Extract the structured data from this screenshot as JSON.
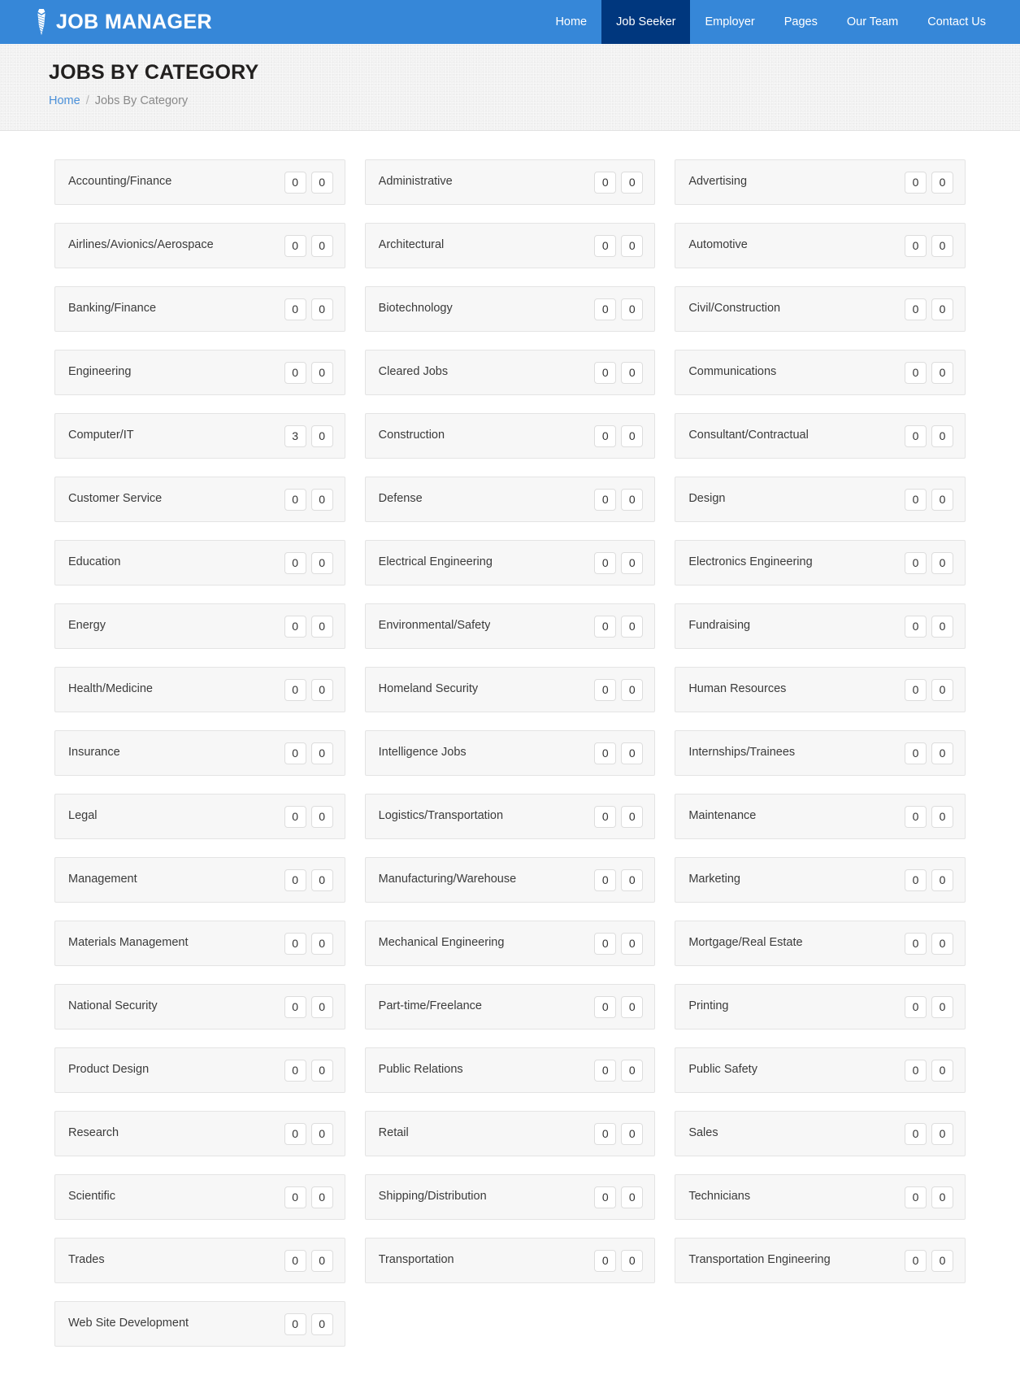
{
  "header": {
    "brand": "JOB MANAGER",
    "brand_icon": "necktie-icon",
    "nav": [
      {
        "label": "Home",
        "active": false
      },
      {
        "label": "Job Seeker",
        "active": true
      },
      {
        "label": "Employer",
        "active": false
      },
      {
        "label": "Pages",
        "active": false
      },
      {
        "label": "Our Team",
        "active": false
      },
      {
        "label": "Contact Us",
        "active": false
      }
    ]
  },
  "banner": {
    "title": "JOBS BY CATEGORY",
    "breadcrumb": {
      "home": "Home",
      "separator": "/",
      "current": "Jobs By Category"
    }
  },
  "colors": {
    "header_blue": "#3687d8",
    "active_nav": "#00377e",
    "link_blue": "#4a90d9",
    "banner_bg": "#f1f1f1",
    "card_bg": "#f7f7f7",
    "card_border": "#e4e4e4",
    "badge_bg": "#ffffff",
    "badge_border": "#dddddd"
  },
  "categories": [
    {
      "name": "Accounting/Finance",
      "count_a": "0",
      "count_b": "0"
    },
    {
      "name": "Administrative",
      "count_a": "0",
      "count_b": "0"
    },
    {
      "name": "Advertising",
      "count_a": "0",
      "count_b": "0"
    },
    {
      "name": "Airlines/Avionics/Aerospace",
      "count_a": "0",
      "count_b": "0"
    },
    {
      "name": "Architectural",
      "count_a": "0",
      "count_b": "0"
    },
    {
      "name": "Automotive",
      "count_a": "0",
      "count_b": "0"
    },
    {
      "name": "Banking/Finance",
      "count_a": "0",
      "count_b": "0"
    },
    {
      "name": "Biotechnology",
      "count_a": "0",
      "count_b": "0"
    },
    {
      "name": "Civil/Construction",
      "count_a": "0",
      "count_b": "0"
    },
    {
      "name": "Engineering",
      "count_a": "0",
      "count_b": "0"
    },
    {
      "name": "Cleared Jobs",
      "count_a": "0",
      "count_b": "0"
    },
    {
      "name": "Communications",
      "count_a": "0",
      "count_b": "0"
    },
    {
      "name": "Computer/IT",
      "count_a": "3",
      "count_b": "0"
    },
    {
      "name": "Construction",
      "count_a": "0",
      "count_b": "0"
    },
    {
      "name": "Consultant/Contractual",
      "count_a": "0",
      "count_b": "0"
    },
    {
      "name": "Customer Service",
      "count_a": "0",
      "count_b": "0"
    },
    {
      "name": "Defense",
      "count_a": "0",
      "count_b": "0"
    },
    {
      "name": "Design",
      "count_a": "0",
      "count_b": "0"
    },
    {
      "name": "Education",
      "count_a": "0",
      "count_b": "0"
    },
    {
      "name": "Electrical Engineering",
      "count_a": "0",
      "count_b": "0"
    },
    {
      "name": "Electronics Engineering",
      "count_a": "0",
      "count_b": "0"
    },
    {
      "name": "Energy",
      "count_a": "0",
      "count_b": "0"
    },
    {
      "name": "Environmental/Safety",
      "count_a": "0",
      "count_b": "0"
    },
    {
      "name": "Fundraising",
      "count_a": "0",
      "count_b": "0"
    },
    {
      "name": "Health/Medicine",
      "count_a": "0",
      "count_b": "0"
    },
    {
      "name": "Homeland Security",
      "count_a": "0",
      "count_b": "0"
    },
    {
      "name": "Human Resources",
      "count_a": "0",
      "count_b": "0"
    },
    {
      "name": "Insurance",
      "count_a": "0",
      "count_b": "0"
    },
    {
      "name": "Intelligence Jobs",
      "count_a": "0",
      "count_b": "0"
    },
    {
      "name": "Internships/Trainees",
      "count_a": "0",
      "count_b": "0"
    },
    {
      "name": "Legal",
      "count_a": "0",
      "count_b": "0"
    },
    {
      "name": "Logistics/Transportation",
      "count_a": "0",
      "count_b": "0"
    },
    {
      "name": "Maintenance",
      "count_a": "0",
      "count_b": "0"
    },
    {
      "name": "Management",
      "count_a": "0",
      "count_b": "0"
    },
    {
      "name": "Manufacturing/Warehouse",
      "count_a": "0",
      "count_b": "0"
    },
    {
      "name": "Marketing",
      "count_a": "0",
      "count_b": "0"
    },
    {
      "name": "Materials Management",
      "count_a": "0",
      "count_b": "0"
    },
    {
      "name": "Mechanical Engineering",
      "count_a": "0",
      "count_b": "0"
    },
    {
      "name": "Mortgage/Real Estate",
      "count_a": "0",
      "count_b": "0"
    },
    {
      "name": "National Security",
      "count_a": "0",
      "count_b": "0"
    },
    {
      "name": "Part-time/Freelance",
      "count_a": "0",
      "count_b": "0"
    },
    {
      "name": "Printing",
      "count_a": "0",
      "count_b": "0"
    },
    {
      "name": "Product Design",
      "count_a": "0",
      "count_b": "0"
    },
    {
      "name": "Public Relations",
      "count_a": "0",
      "count_b": "0"
    },
    {
      "name": "Public Safety",
      "count_a": "0",
      "count_b": "0"
    },
    {
      "name": "Research",
      "count_a": "0",
      "count_b": "0"
    },
    {
      "name": "Retail",
      "count_a": "0",
      "count_b": "0"
    },
    {
      "name": "Sales",
      "count_a": "0",
      "count_b": "0"
    },
    {
      "name": "Scientific",
      "count_a": "0",
      "count_b": "0"
    },
    {
      "name": "Shipping/Distribution",
      "count_a": "0",
      "count_b": "0"
    },
    {
      "name": "Technicians",
      "count_a": "0",
      "count_b": "0"
    },
    {
      "name": "Trades",
      "count_a": "0",
      "count_b": "0"
    },
    {
      "name": "Transportation",
      "count_a": "0",
      "count_b": "0"
    },
    {
      "name": "Transportation Engineering",
      "count_a": "0",
      "count_b": "0"
    },
    {
      "name": "Web Site Development",
      "count_a": "0",
      "count_b": "0"
    }
  ]
}
